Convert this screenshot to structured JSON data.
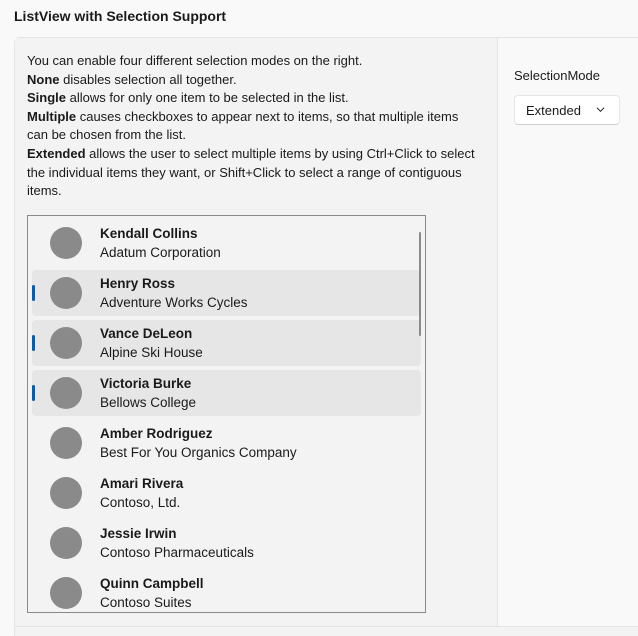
{
  "page": {
    "section_title": "ListView with Selection Support"
  },
  "description": {
    "intro": "You can enable four different selection modes on the right.",
    "none_term": "None",
    "none_text": " disables selection all together.",
    "single_term": "Single",
    "single_text": " allows for only one item to be selected in the list.",
    "multiple_term": "Multiple",
    "multiple_text": " causes checkboxes to appear next to items, so that multiple items can be chosen from the list.",
    "extended_term": "Extended",
    "extended_text": " allows the user to select multiple items by using Ctrl+Click to select the individual items they want, or Shift+Click to select a range of contiguous items."
  },
  "contacts": [
    {
      "name": "Kendall Collins",
      "company": "Adatum Corporation",
      "selected": false
    },
    {
      "name": "Henry Ross",
      "company": "Adventure Works Cycles",
      "selected": true
    },
    {
      "name": "Vance DeLeon",
      "company": "Alpine Ski House",
      "selected": true
    },
    {
      "name": "Victoria Burke",
      "company": "Bellows College",
      "selected": true
    },
    {
      "name": "Amber Rodriguez",
      "company": "Best For You Organics Company",
      "selected": false
    },
    {
      "name": "Amari Rivera",
      "company": "Contoso, Ltd.",
      "selected": false
    },
    {
      "name": "Jessie Irwin",
      "company": "Contoso Pharmaceuticals",
      "selected": false
    },
    {
      "name": "Quinn Campbell",
      "company": "Contoso Suites",
      "selected": false
    }
  ],
  "options": {
    "selection_mode_label": "SelectionMode",
    "selection_mode_value": "Extended"
  },
  "colors": {
    "accent": "#005fb8",
    "avatar": "#8a8a8a",
    "selected_background": "#e6e6e6"
  },
  "icons": {
    "combo_chevron": "chevron-down-icon",
    "avatar": "person-avatar-placeholder"
  }
}
